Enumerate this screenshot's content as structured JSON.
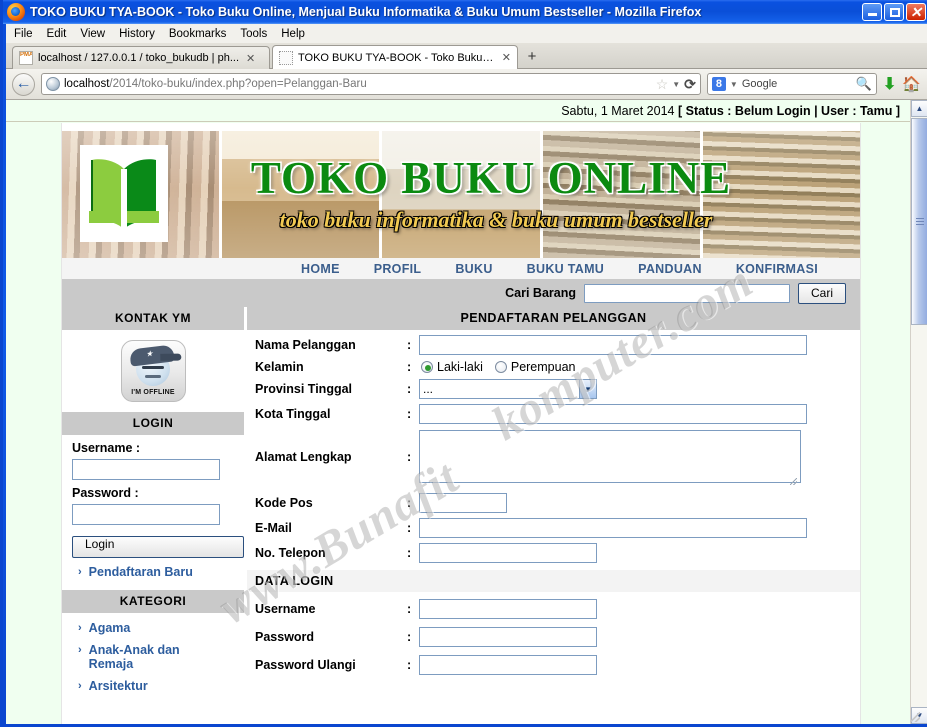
{
  "browser": {
    "window_title": "TOKO BUKU TYA-BOOK - Toko Buku Online, Menjual Buku Informatika & Buku Umum Bestseller - Mozilla Firefox",
    "menus": [
      "File",
      "Edit",
      "View",
      "History",
      "Bookmarks",
      "Tools",
      "Help"
    ],
    "tabs": [
      {
        "label": "localhost / 127.0.0.1 / toko_bukudb | ph...",
        "favicon": "phpmyadmin-icon",
        "active": false
      },
      {
        "label": "TOKO BUKU TYA-BOOK - Toko Buku Onlin...",
        "favicon": "blank-icon",
        "active": true
      }
    ],
    "new_tab_label": "+",
    "url_prefix": "localhost",
    "url_rest": "/2014/toko-buku/index.php?open=Pelanggan-Baru",
    "search_engine": "Google",
    "search_badge": "8",
    "window_buttons": {
      "minimize": "_",
      "maximize": "□",
      "close": "✕"
    }
  },
  "page": {
    "status_date": "Sabtu, 1 Maret 2014",
    "status_info": "[ Status : Belum Login | User : Tamu ]",
    "banner": {
      "title": "TOKO BUKU ONLINE",
      "subtitle": "toko buku informatika & buku umum bestseller",
      "logo_name": "open-book-logo"
    },
    "nav_items": [
      "HOME",
      "PROFIL",
      "BUKU",
      "BUKU TAMU",
      "PANDUAN",
      "KONFIRMASI"
    ],
    "search": {
      "label": "Cari Barang",
      "value": "",
      "placeholder": "",
      "button": "Cari"
    },
    "watermark": [
      "www.Bunafit",
      "komputer.com"
    ]
  },
  "sidebar": {
    "ym": {
      "heading": "KONTAK YM",
      "status_text": "I'M OFFLINE"
    },
    "login": {
      "heading": "LOGIN",
      "username_label": "Username :",
      "username_value": "",
      "password_label": "Password :",
      "password_value": "",
      "button": "Login",
      "register_link": "Pendaftaran Baru"
    },
    "kategori": {
      "heading": "KATEGORI",
      "items": [
        "Agama",
        "Anak-Anak dan Remaja",
        "Arsitektur"
      ]
    }
  },
  "form": {
    "heading": "PENDAFTARAN PELANGGAN",
    "fields": [
      {
        "label": "Nama Pelanggan",
        "sep": ":",
        "type": "text",
        "value": "",
        "width": "long"
      },
      {
        "label": "Kelamin",
        "sep": ":",
        "type": "radio",
        "options": [
          "Laki-laki",
          "Perempuan"
        ],
        "selected": "Laki-laki"
      },
      {
        "label": "Provinsi Tinggal",
        "sep": ":",
        "type": "select",
        "value": "...",
        "options": [
          "..."
        ]
      },
      {
        "label": "Kota Tinggal",
        "sep": ":",
        "type": "text",
        "value": "",
        "width": "long"
      },
      {
        "label": "Alamat Lengkap",
        "sep": ":",
        "type": "textarea",
        "value": ""
      },
      {
        "label": "Kode Pos",
        "sep": ":",
        "type": "text",
        "value": "",
        "width": "small"
      },
      {
        "label": "E-Mail",
        "sep": ":",
        "type": "text",
        "value": "",
        "width": "long"
      },
      {
        "label": "No. Telepon",
        "sep": ":",
        "type": "text",
        "value": "",
        "width": "mid"
      }
    ],
    "login_section": {
      "heading": "DATA LOGIN",
      "fields": [
        {
          "label": "Username",
          "sep": ":",
          "type": "text",
          "value": "",
          "width": "mid"
        },
        {
          "label": "Password",
          "sep": ":",
          "type": "password",
          "value": "",
          "width": "mid"
        },
        {
          "label": "Password Ulangi",
          "sep": ":",
          "type": "password",
          "value": "",
          "width": "mid"
        }
      ]
    }
  },
  "colors": {
    "title_bar": "#0a4fd8",
    "brand_green": "#0b8a10",
    "subtitle_gold": "#f2ca52",
    "nav_link": "#3b5e8c",
    "panel_gray": "#c9c9c9",
    "page_bg": "#f0fff0"
  }
}
